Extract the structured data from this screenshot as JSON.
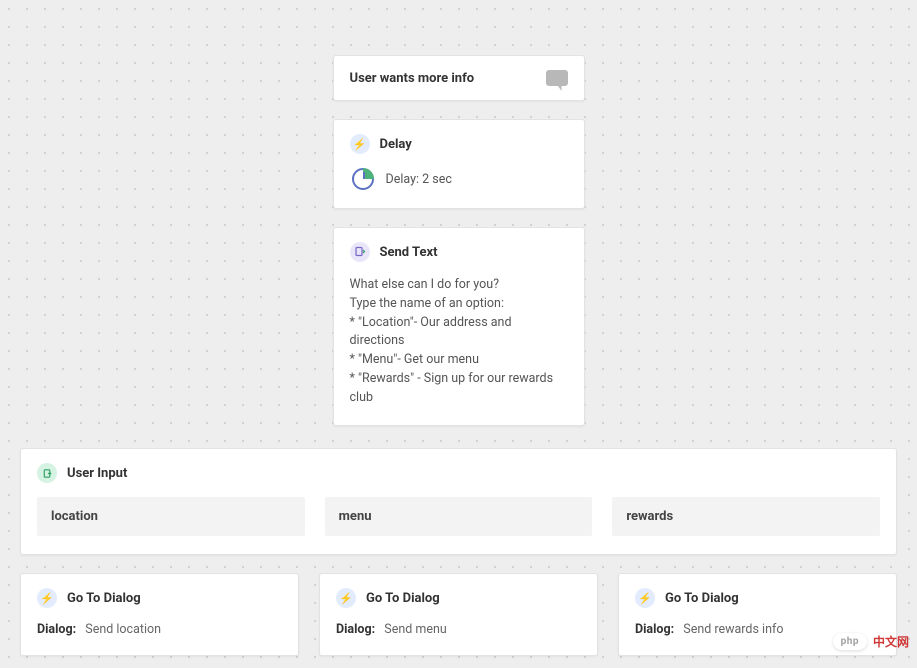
{
  "header": {
    "title": "User wants more info"
  },
  "delay": {
    "title": "Delay",
    "text": "Delay: 2 sec"
  },
  "sendtext": {
    "title": "Send Text",
    "lines": [
      "What else can I do for you?",
      "Type the name of an option:",
      "* \"Location\"- Our address and directions",
      "* \"Menu\"- Get our menu",
      "* \"Rewards\" - Sign up for our rewards club"
    ]
  },
  "userinput": {
    "title": "User Input",
    "options": [
      "location",
      "menu",
      "rewards"
    ]
  },
  "branches": [
    {
      "title": "Go To Dialog",
      "label": "Dialog:",
      "target": "Send location"
    },
    {
      "title": "Go To Dialog",
      "label": "Dialog:",
      "target": "Send menu"
    },
    {
      "title": "Go To Dialog",
      "label": "Dialog:",
      "target": "Send rewards info"
    }
  ],
  "watermark": {
    "badge": "php",
    "text": "中文网"
  }
}
